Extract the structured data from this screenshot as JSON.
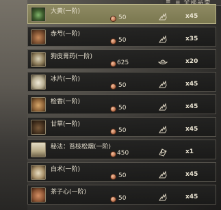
{
  "header": {
    "label": "≡ 全部品类"
  },
  "items": [
    {
      "name": "大黄(一阶)",
      "price": "50",
      "action_icon": "gather-hand-icon",
      "qty": "x45",
      "thumb": "herb-green",
      "selected": true
    },
    {
      "name": "赤芍(一阶)",
      "price": "50",
      "action_icon": "gather-hand-icon",
      "qty": "x35",
      "thumb": "herb-brown",
      "selected": false
    },
    {
      "name": "狗皮膏药(一阶)",
      "price": "625",
      "action_icon": "bowl-icon",
      "qty": "x20",
      "thumb": "jar",
      "selected": false
    },
    {
      "name": "冰片(一阶)",
      "price": "50",
      "action_icon": "gather-hand-icon",
      "qty": "x45",
      "thumb": "white",
      "selected": false
    },
    {
      "name": "检香(一阶)",
      "price": "50",
      "action_icon": "gather-hand-icon",
      "qty": "x45",
      "thumb": "root",
      "selected": false
    },
    {
      "name": "甘草(一阶)",
      "price": "50",
      "action_icon": "gather-hand-icon",
      "qty": "x45",
      "thumb": "dark",
      "selected": false
    },
    {
      "name": "秘法：苔枝松烟(一阶)",
      "price": "450",
      "action_icon": "recipe-icon",
      "qty": "x1",
      "thumb": "scroll",
      "selected": false
    },
    {
      "name": "白术(一阶)",
      "price": "50",
      "action_icon": "gather-hand-icon",
      "qty": "x45",
      "thumb": "grain",
      "selected": false
    },
    {
      "name": "茶子心(一阶)",
      "price": "50",
      "action_icon": "gather-hand-icon",
      "qty": "x45",
      "thumb": "seed",
      "selected": false
    }
  ]
}
